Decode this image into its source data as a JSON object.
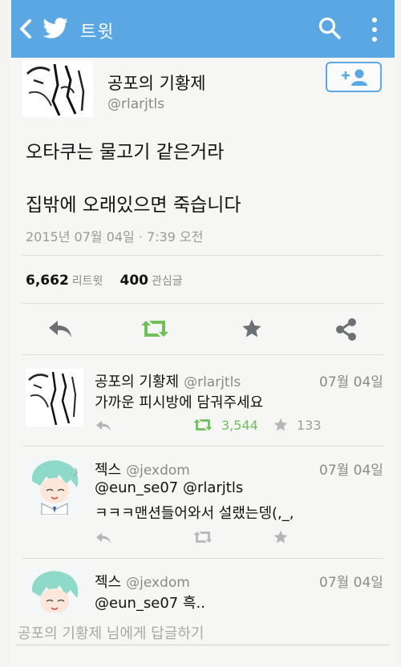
{
  "appbar": {
    "title": "트윗",
    "color": "#5ba7e4"
  },
  "tweet": {
    "author_name": "공포의 기황제",
    "author_handle": "@rlarjtls",
    "text_line1": "오타쿠는 물고기 같은거라",
    "text_line2": "집밖에 오래있으면 죽습니다",
    "datetime": "2015년 07월 04일 · 7:39 오전",
    "retweet_count": "6,662",
    "retweet_label": "리트윗",
    "like_count": "400",
    "like_label": "관심글"
  },
  "replies": [
    {
      "name": "공포의 기황제",
      "handle": "@rlarjtls",
      "date": "07월 04일",
      "text1": "가까운 피시방에 담궈주세요",
      "text2": "",
      "retweets": "3,544",
      "likes": "133"
    },
    {
      "name": "젝스",
      "handle": "@jexdom",
      "date": "07월 04일",
      "text1": "@eun_se07 @rlarjtls",
      "text2": "ㅋㅋㅋ맨션들어와서 설랬는뎅(,_,"
    },
    {
      "name": "젝스",
      "handle": "@jexdom",
      "date": "07월 04일",
      "text1": "@eun_se07  흑..",
      "text2": ""
    }
  ],
  "reply_box": {
    "placeholder": "공포의 기황제 님에게 답글하기"
  },
  "colors": {
    "accent": "#5ba7e4",
    "retweet_green": "#6fbf5a",
    "icon_gray": "#6c7176"
  }
}
